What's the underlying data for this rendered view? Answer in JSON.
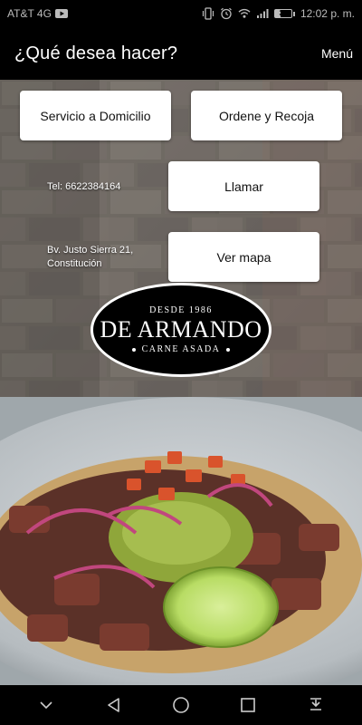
{
  "status_bar": {
    "carrier": "AT&T 4G",
    "battery": "31",
    "time": "12:02 p. m."
  },
  "header": {
    "title": "¿Qué desea hacer?",
    "menu_label": "Menú"
  },
  "buttons": {
    "domicilio": "Servicio a Domicilio",
    "recoja": "Ordene y Recoja",
    "llamar": "Llamar",
    "mapa": "Ver mapa"
  },
  "contact": {
    "phone": "Tel: 6622384164",
    "address": "Bv. Justo Sierra 21, Constitución"
  },
  "logo": {
    "since": "DESDE 1986",
    "name": "DE ARMANDO",
    "tagline": "CARNE ASADA"
  },
  "icons": {
    "status": [
      "youtube-icon",
      "vibrate-icon",
      "alarm-icon",
      "wifi-icon",
      "signal-icon",
      "battery-icon"
    ],
    "nav": [
      "dropdown-icon",
      "back-icon",
      "home-icon",
      "recents-icon",
      "notifications-icon"
    ]
  }
}
